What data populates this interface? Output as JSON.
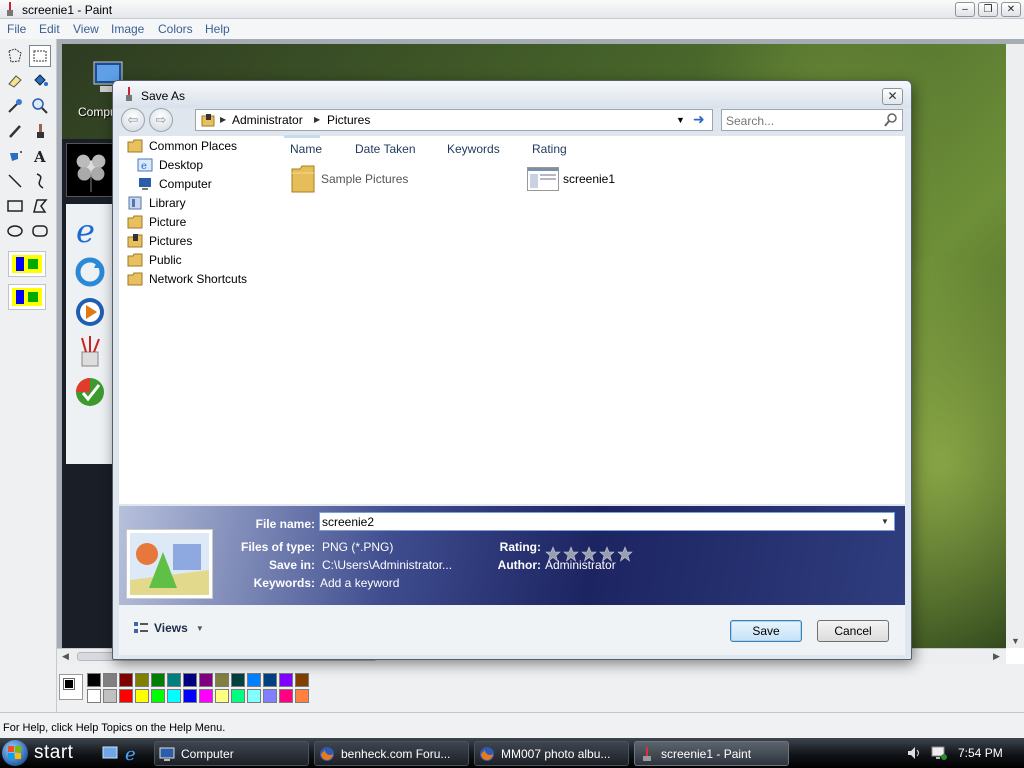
{
  "paint": {
    "title": "screenie1 - Paint",
    "menu": [
      "File",
      "Edit",
      "View",
      "Image",
      "Colors",
      "Help"
    ],
    "status_text": "For Help, click Help Topics on the Help Menu."
  },
  "desktop": {
    "computer_label": "Compu"
  },
  "palette": {
    "top": [
      "#000000",
      "#808080",
      "#800000",
      "#808000",
      "#008000",
      "#008080",
      "#000080",
      "#800080",
      "#808040",
      "#004040",
      "#0080ff",
      "#004080",
      "#8000ff",
      "#804000"
    ],
    "bottom": [
      "#ffffff",
      "#c0c0c0",
      "#ff0000",
      "#ffff00",
      "#00ff00",
      "#00ffff",
      "#0000ff",
      "#ff00ff",
      "#ffff80",
      "#00ff80",
      "#80ffff",
      "#8080ff",
      "#ff0080",
      "#ff8040"
    ]
  },
  "dialog": {
    "title": "Save As",
    "close_label": "✕",
    "breadcrumb": [
      "Administrator",
      "Pictures"
    ],
    "search_placeholder": "Search...",
    "nav_items": [
      {
        "label": "Common Places",
        "icon": "folder-icon"
      },
      {
        "label": "Desktop",
        "icon": "desktop-icon"
      },
      {
        "label": "Computer",
        "icon": "computer-icon"
      },
      {
        "label": "Library",
        "icon": "library-icon"
      },
      {
        "label": "Picture",
        "icon": "folder-icon"
      },
      {
        "label": "Pictures",
        "icon": "pictures-folder-icon"
      },
      {
        "label": "Public",
        "icon": "folder-icon"
      },
      {
        "label": "Network Shortcuts",
        "icon": "folder-icon"
      }
    ],
    "columns": [
      "Name",
      "Date Taken",
      "Keywords",
      "Rating"
    ],
    "files": [
      {
        "name": "Sample Pictures",
        "icon": "folder-icon"
      },
      {
        "name": "screenie1",
        "icon": "image-thumbnail-icon"
      }
    ],
    "details": {
      "file_name_label": "File name:",
      "file_name_value": "screenie2",
      "files_of_type_label": "Files of type:",
      "files_of_type_value": "PNG (*.PNG)",
      "save_in_label": "Save in:",
      "save_in_value": "C:\\Users\\Administrator...",
      "keywords_label": "Keywords:",
      "keywords_value": "Add a keyword",
      "rating_label": "Rating:",
      "rating_stars": 0,
      "author_label": "Author:",
      "author_value": "Administrator"
    },
    "views_label": "Views",
    "save_label": "Save",
    "cancel_label": "Cancel"
  },
  "taskbar": {
    "start_label": "start",
    "tasks": [
      {
        "label": "Computer",
        "icon": "computer-icon"
      },
      {
        "label": "benheck.com Foru...",
        "icon": "firefox-icon"
      },
      {
        "label": "MM007 photo albu...",
        "icon": "firefox-icon"
      },
      {
        "label": "screenie1 - Paint",
        "icon": "paint-icon"
      }
    ],
    "clock": "7:54 PM"
  }
}
